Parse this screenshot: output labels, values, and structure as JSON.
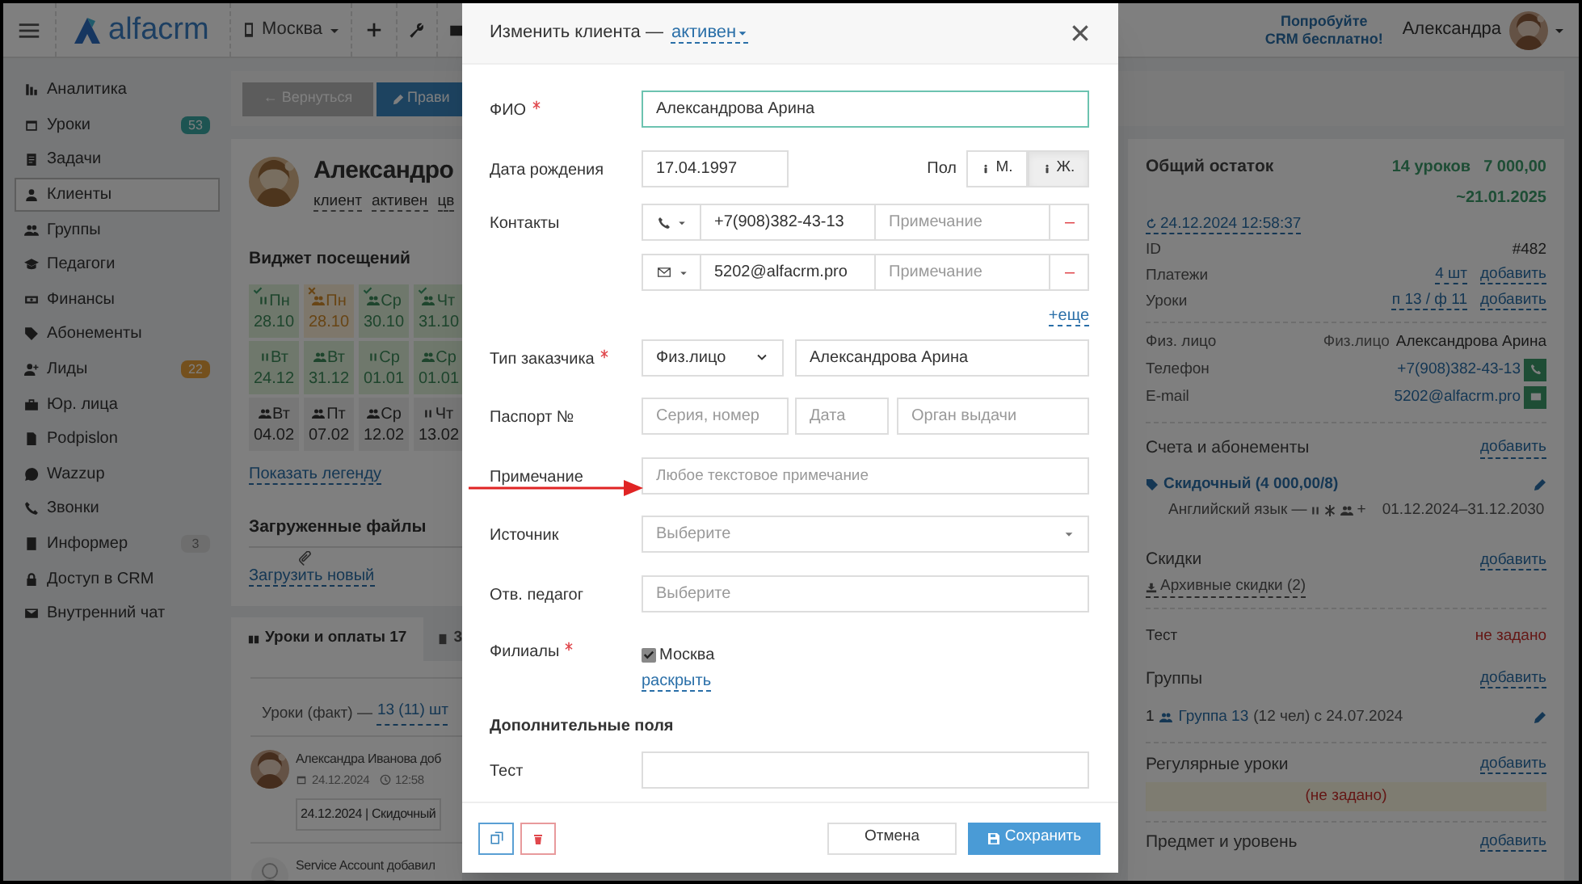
{
  "header": {
    "logo": "alfacrm",
    "branch": "Москва",
    "promo": [
      "Попробуйте",
      "CRM бесплатно!"
    ],
    "user": "Александра"
  },
  "sidebar": {
    "items": [
      {
        "label": "Аналитика",
        "selected": false
      },
      {
        "label": "Уроки",
        "selected": false,
        "badge": "53",
        "color": "#1d5452"
      },
      {
        "label": "Задачи",
        "selected": false
      },
      {
        "label": "Клиенты",
        "selected": true
      },
      {
        "label": "Группы",
        "selected": false
      },
      {
        "label": "Педагоги",
        "selected": false
      },
      {
        "label": "Финансы",
        "selected": false
      },
      {
        "label": "Абонементы",
        "selected": false
      },
      {
        "label": "Лиды",
        "selected": false,
        "badge": "22",
        "color": "#74501d"
      },
      {
        "label": "Юр. лица",
        "selected": false
      },
      {
        "label": "Podpislon",
        "selected": false
      },
      {
        "label": "Wazzup",
        "selected": false
      },
      {
        "label": "Звонки",
        "selected": false
      },
      {
        "label": "Информер",
        "selected": false,
        "badge": "3",
        "color": "#6e6e6e"
      },
      {
        "label": "Доступ в CRM",
        "selected": false
      },
      {
        "label": "Внутренний чат",
        "selected": false
      }
    ]
  },
  "toolbar": {
    "back": "← Вернуться",
    "edit": "Прави"
  },
  "client": {
    "name": "Александро",
    "tags": [
      "клиент",
      "активен",
      "цв"
    ]
  },
  "visits_widget": {
    "title": "Виджет посещений",
    "cells": [
      {
        "kind": "individual",
        "day": "Пн",
        "date": "28.10",
        "color": "#6f786c",
        "attended": true,
        "missed": false
      },
      {
        "kind": "group",
        "day": "Пн",
        "date": "28.10",
        "color": "#7e776b",
        "attended": false,
        "missed": true
      },
      {
        "kind": "group",
        "day": "Ср",
        "date": "30.10",
        "color": "#6f786c",
        "attended": true,
        "missed": false
      },
      {
        "kind": "group",
        "day": "Чт",
        "date": "31.10",
        "color": "#6f786c",
        "attended": true,
        "missed": false
      },
      {
        "kind": "individual",
        "day": "Вт",
        "date": "24.12",
        "color": "#6f786c",
        "attended": false,
        "missed": false
      },
      {
        "kind": "group",
        "day": "Вт",
        "date": "31.12",
        "color": "#6f786c",
        "attended": false,
        "missed": false
      },
      {
        "kind": "individual",
        "day": "Ср",
        "date": "01.01",
        "color": "#6f786c",
        "attended": false,
        "missed": false
      },
      {
        "kind": "group",
        "day": "Ср",
        "date": "01.01",
        "color": "#6f786c",
        "attended": false,
        "missed": false
      },
      {
        "kind": "group",
        "day": "Вт",
        "date": "04.02",
        "color": "#777777",
        "attended": false,
        "missed": false
      },
      {
        "kind": "group",
        "day": "Пт",
        "date": "07.02",
        "color": "#777777",
        "attended": false,
        "missed": false
      },
      {
        "kind": "group",
        "day": "Ср",
        "date": "12.02",
        "color": "#777777",
        "attended": false,
        "missed": false
      },
      {
        "kind": "individual",
        "day": "Чт",
        "date": "13.02",
        "color": "#777777",
        "attended": false,
        "missed": false
      }
    ],
    "legend": "Показать легенду"
  },
  "files": {
    "title": "Загруженные файлы",
    "upload": "Загрузить новый"
  },
  "tabs": [
    {
      "label": "Уроки и оплаты 17",
      "selected": true
    },
    {
      "label": "3",
      "selected": false
    }
  ],
  "lessons_summary": {
    "label": "Уроки (факт) —",
    "count": "13 (11) шт"
  },
  "feed": [
    {
      "kind": "user",
      "text": "Александра Иванова доб",
      "date": "24.12.2024",
      "time": "12:58",
      "detail": "24.12.2024 | Скидочный"
    },
    {
      "kind": "system",
      "text": "Service Account добавил"
    }
  ],
  "summary": {
    "balance_label": "Общий остаток",
    "lessons": "14 уроков",
    "amount": "7 000,00",
    "until": "~21.01.2025",
    "updated": "24.12.2024 12:58:37",
    "details": [
      {
        "label": "ID",
        "value": "#482",
        "kind": "plain"
      },
      {
        "label": "Платежи",
        "value": "4 шт",
        "kind": "link",
        "action": "добавить"
      },
      {
        "label": "Уроки",
        "value": "п 13 / ф 11",
        "kind": "link",
        "action": "добавить"
      }
    ],
    "contacts": [
      {
        "label": "Физ. лицо",
        "prefix": "Физ.лицо",
        "value": "Александрова Арина",
        "kind": "person"
      },
      {
        "label": "Телефон",
        "value": "+7(908)382-43-13",
        "kind": "phone"
      },
      {
        "label": "E-mail",
        "value": "5202@alfacrm.pro",
        "kind": "email"
      }
    ],
    "subscriptions": {
      "title": "Счета и абонементы",
      "action": "добавить",
      "name": "Скидочный (4 000,00/8)",
      "subject": "Английский язык —",
      "plus": "+",
      "period": "01.12.2024–31.12.2030"
    },
    "discounts": {
      "title": "Скидки",
      "action": "добавить",
      "archive": "Архивные скидки (2)"
    },
    "custom": {
      "label": "Тест",
      "value": "не задано"
    },
    "groups": {
      "title": "Группы",
      "action": "добавить",
      "items": [
        {
          "count": "1",
          "name": "Группа 13",
          "info": "(12 чел) с 24.07.2024"
        }
      ]
    },
    "regular": {
      "title": "Регулярные уроки",
      "action": "добавить",
      "empty": "(не задано)"
    },
    "subject": {
      "title": "Предмет и уровень",
      "action": "добавить"
    }
  },
  "modal": {
    "title": "Изменить клиента —",
    "status": "активен",
    "fields": [
      {
        "kind": "text",
        "label": "ФИО",
        "required": true,
        "focused": true,
        "value": "Александрова Арина"
      },
      {
        "kind": "date",
        "label": "Дата рождения",
        "required": false,
        "value": "17.04.1997",
        "gender_label": "Пол",
        "options": [
          {
            "label": "М.",
            "selected": false
          },
          {
            "label": "Ж.",
            "selected": true
          }
        ]
      },
      {
        "kind": "contacts",
        "label": "Контакты",
        "required": false,
        "items": [
          {
            "kind": "phone",
            "value": "+7(908)382-43-13",
            "note_placeholder": "Примечание"
          },
          {
            "kind": "email",
            "value": "5202@alfacrm.pro",
            "note_placeholder": "Примечание"
          }
        ],
        "more": "+еще"
      },
      {
        "kind": "customer_type",
        "label": "Тип заказчика",
        "required": true,
        "type": "Физ.лицо",
        "value": "Александрова Арина"
      },
      {
        "kind": "passport",
        "label": "Паспорт №",
        "required": false,
        "placeholders": [
          "Серия, номер",
          "Дата",
          "Орган выдачи"
        ]
      },
      {
        "kind": "textarea",
        "label": "Примечание",
        "required": false,
        "placeholder": "Любое текстовое примечание"
      },
      {
        "kind": "select",
        "label": "Источник",
        "required": false,
        "placeholder": "Выберите"
      },
      {
        "kind": "autocomplete",
        "label": "Отв. педагог",
        "required": false,
        "placeholder": "Выберите"
      },
      {
        "kind": "checkboxes",
        "label": "Филиалы",
        "required": true,
        "items": [
          {
            "label": "Москва",
            "checked": true
          }
        ],
        "expand": "раскрыть"
      },
      {
        "kind": "section",
        "label": "Дополнительные поля"
      },
      {
        "kind": "textarea",
        "label": "Тест",
        "required": false
      }
    ],
    "cancel": "Отмена",
    "save": "Сохранить"
  }
}
